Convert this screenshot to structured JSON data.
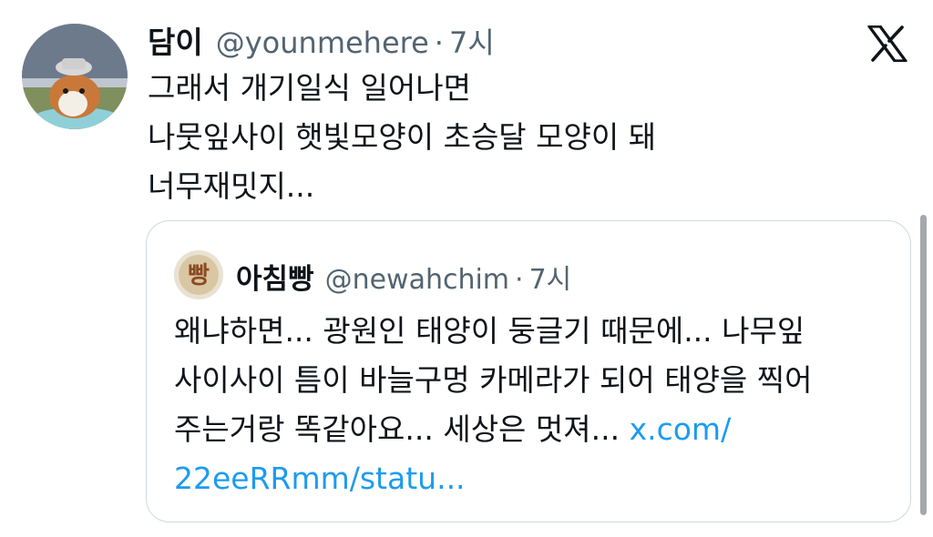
{
  "tweet": {
    "author_name": "담이",
    "handle": "@younmehere",
    "separator": "·",
    "time": "7시",
    "avatar_icon": "guinea-pig-photo-avatar",
    "lines": [
      "그래서 개기일식 일어나면",
      "나뭇잎사이 햇빛모양이 초승달 모양이 돼",
      "너무재밋지..."
    ]
  },
  "brand": {
    "logo_icon": "x-logo-icon"
  },
  "quote": {
    "author_name": "아침빵",
    "handle": "@newahchim",
    "separator": "·",
    "time": "7시",
    "avatar_icon": "bread-avatar",
    "avatar_text": "빵",
    "lines": [
      "왜냐하면... 광원인 태양이 둥글기 때문에... 나무잎",
      "사이사이 틈이 바늘구멍 카메라가 되어 태양을 찍어",
      "주는거랑 똑같아요... 세상은 멋져... "
    ],
    "link_part1": "x.com/",
    "link_part2": "22eeRRmm/statu..."
  },
  "colors": {
    "text": "#0f1419",
    "secondary": "#536471",
    "link": "#1d9bf0",
    "border": "#cfd9de"
  }
}
